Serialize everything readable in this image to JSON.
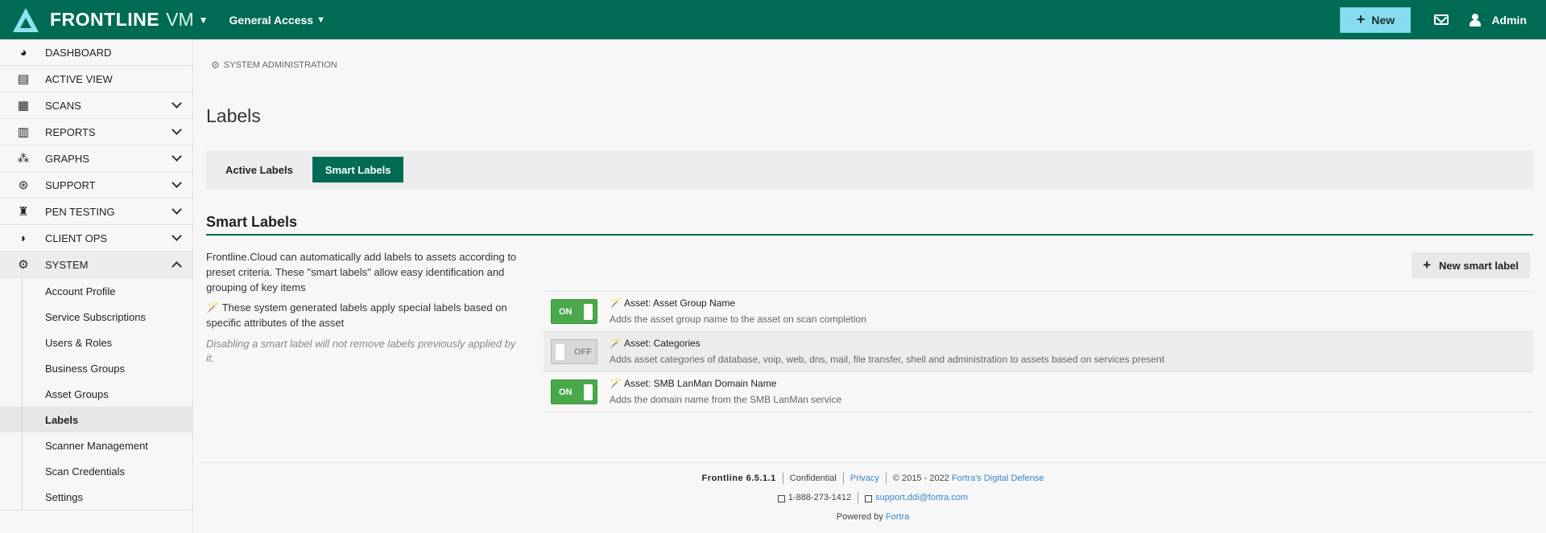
{
  "header": {
    "brand": "FRONTLINE",
    "product": "VM",
    "access_label": "General Access",
    "new_label": "New",
    "admin_label": "Admin"
  },
  "sidebar": {
    "items": [
      {
        "label": "DASHBOARD",
        "icon": "dashboard-icon",
        "glyph": "◕"
      },
      {
        "label": "ACTIVE VIEW",
        "icon": "bar-chart-icon",
        "glyph": "▤"
      },
      {
        "label": "SCANS",
        "icon": "qr-code-icon",
        "glyph": "▦"
      },
      {
        "label": "REPORTS",
        "icon": "document-icon",
        "glyph": "▥"
      },
      {
        "label": "GRAPHS",
        "icon": "nodes-icon",
        "glyph": "⁂"
      },
      {
        "label": "SUPPORT",
        "icon": "lifebuoy-icon",
        "glyph": "⊛"
      },
      {
        "label": "PEN TESTING",
        "icon": "spy-icon",
        "glyph": "♜"
      },
      {
        "label": "CLIENT OPS",
        "icon": "shield-icon",
        "glyph": "◗"
      },
      {
        "label": "SYSTEM",
        "icon": "gears-icon",
        "glyph": "⚙"
      }
    ],
    "system_sub": [
      "Account Profile",
      "Service Subscriptions",
      "Users & Roles",
      "Business Groups",
      "Asset Groups",
      "Labels",
      "Scanner Management",
      "Scan Credentials",
      "Settings"
    ]
  },
  "main": {
    "breadcrumb": "SYSTEM ADMINISTRATION",
    "title": "Labels",
    "tabs": [
      {
        "label": "Active Labels",
        "selected": false
      },
      {
        "label": "Smart Labels",
        "selected": true
      }
    ],
    "section_title": "Smart Labels",
    "description": "Frontline.Cloud can automatically add labels to assets according to preset criteria. These \"smart labels\" allow easy identification and grouping of key items",
    "system_note": "These system generated labels apply special labels based on specific attributes of the asset",
    "disable_note": "Disabling a smart label will not remove labels previously applied by it.",
    "new_smart_label": "New smart label",
    "labels": [
      {
        "state": "ON",
        "name": "Asset: Asset Group Name",
        "desc": "Adds the asset group name to the asset on scan completion"
      },
      {
        "state": "OFF",
        "name": "Asset: Categories",
        "desc": "Adds asset categories of database, voip, web, dns, mail, file transfer, shell and administration to assets based on services present"
      },
      {
        "state": "ON",
        "name": "Asset: SMB LanMan Domain Name",
        "desc": "Adds the domain name from the SMB LanMan service"
      }
    ]
  },
  "footer": {
    "version": "Frontline 6.5.1.1",
    "confidential": "Confidential",
    "privacy": "Privacy",
    "copyright": "© 2015 - 2022",
    "company": "Fortra's Digital Defense",
    "phone": "1-888-273-1412",
    "email": "support.ddi@fortra.com",
    "powered_by": "Powered by",
    "powered_company": "Fortra"
  },
  "colors": {
    "brand_green": "#006b54",
    "accent_cyan": "#86dcee",
    "toggle_on": "#4aa84a",
    "link_blue": "#3a86c8"
  }
}
